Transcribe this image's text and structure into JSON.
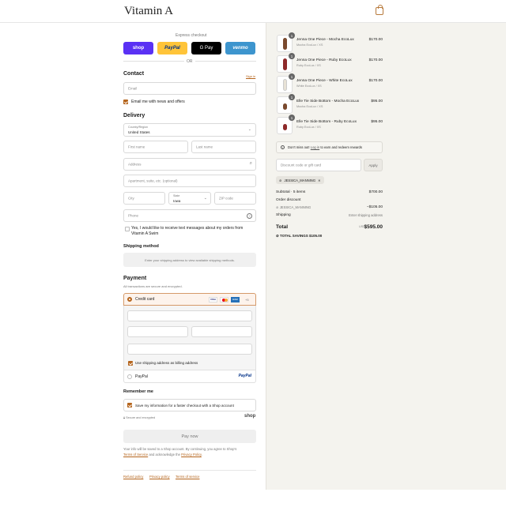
{
  "header": {
    "brand": "Vitamin A"
  },
  "express": {
    "title": "Express checkout",
    "buttons": [
      {
        "label": "shop",
        "bg": "#5a31f4",
        "fg": "#ffffff"
      },
      {
        "label": "PayPal",
        "bg": "#ffc439",
        "fg": "#003087"
      },
      {
        "label": "G Pay",
        "bg": "#000000",
        "fg": "#ffffff"
      },
      {
        "label": "venmo",
        "bg": "#3d95ce",
        "fg": "#ffffff"
      }
    ],
    "or_label": "OR"
  },
  "contact": {
    "title": "Contact",
    "sign_in": "Sign in",
    "email_placeholder": "Email",
    "news_label": "Email me with news and offers"
  },
  "delivery": {
    "title": "Delivery",
    "country_label": "Country/Region",
    "country_value": "United States",
    "first_name": "First name",
    "last_name": "Last name",
    "address": "Address",
    "apartment": "Apartment, suite, etc. (optional)",
    "city": "City",
    "state_label": "State",
    "state_value": "Iowa",
    "zip": "ZIP code",
    "phone": "Phone",
    "sms_label": "Yes, I would like to receive text messages about my orders from Vitamin A Swim"
  },
  "shipping_method": {
    "title": "Shipping method",
    "notice": "Enter your shipping address to view available shipping methods."
  },
  "payment": {
    "title": "Payment",
    "subtitle": "All transactions are secure and encrypted.",
    "credit_card": "Credit card",
    "card_brands": [
      "VISA",
      "MC",
      "AMEX"
    ],
    "more_cards": "+5",
    "billing_label": "Use shipping address as billing address",
    "paypal_option": "PayPal",
    "paypal_logo": "PayPal"
  },
  "remember": {
    "title": "Remember me",
    "save_label": "Save my information for a faster checkout with a Shop account",
    "secure": "Secure and encrypted",
    "shop_logo": "shop"
  },
  "pay_now": "Pay now",
  "legal": {
    "line1": "Your info will be saved to a Shop account. By continuing, you agree to Shop's",
    "tos": "Terms of Service",
    "and": " and acknowledge the ",
    "privacy": "Privacy Policy",
    "end": "."
  },
  "footer_links": [
    "Refund policy",
    "Privacy policy",
    "Terms of service"
  ],
  "cart": {
    "items": [
      {
        "name": "Jenna One Piece - Mocha EcoLux",
        "variant": "Mocha EcoLux / XS",
        "price": "$170.00",
        "qty": "1",
        "color": "#7a4a2e"
      },
      {
        "name": "Jenna One Piece - Ruby EcoLux",
        "variant": "Ruby EcoLux / XS",
        "price": "$170.00",
        "qty": "1",
        "color": "#8e2a2a"
      },
      {
        "name": "Jenna One Piece - White EcoLux",
        "variant": "White EcoLux / XS",
        "price": "$170.00",
        "qty": "1",
        "color": "#e8e2d6"
      },
      {
        "name": "Elle Tie Side Bottom - Mocha EcoLux",
        "variant": "Mocha EcoLux / XS",
        "price": "$95.00",
        "qty": "1",
        "color": "#7a4a2e"
      },
      {
        "name": "Elle Tie Side Bottom - Ruby EcoLux",
        "variant": "Ruby EcoLux / XS",
        "price": "$95.00",
        "qty": "1",
        "color": "#8e2a2a"
      }
    ],
    "rewards": {
      "pre": "Don't miss out! ",
      "link": "Log in",
      "post": " to earn and redeem rewards"
    },
    "discount_placeholder": "Discount code or gift card",
    "apply": "Apply",
    "applied_code": "JESSICA_MANNING",
    "subtotal_label": "Subtotal · 5 items",
    "subtotal_value": "$700.00",
    "order_discount": "Order discount",
    "discount_code": "JESSICA_MANNING",
    "discount_value": "−$105.00",
    "shipping_label": "Shipping",
    "shipping_value": "Enter shipping address",
    "total_label": "Total",
    "currency": "USD",
    "total_value": "$595.00",
    "savings_label": "TOTAL SAVINGS",
    "savings_value": "$105.00"
  },
  "colors": {
    "accent": "#b5651d"
  }
}
